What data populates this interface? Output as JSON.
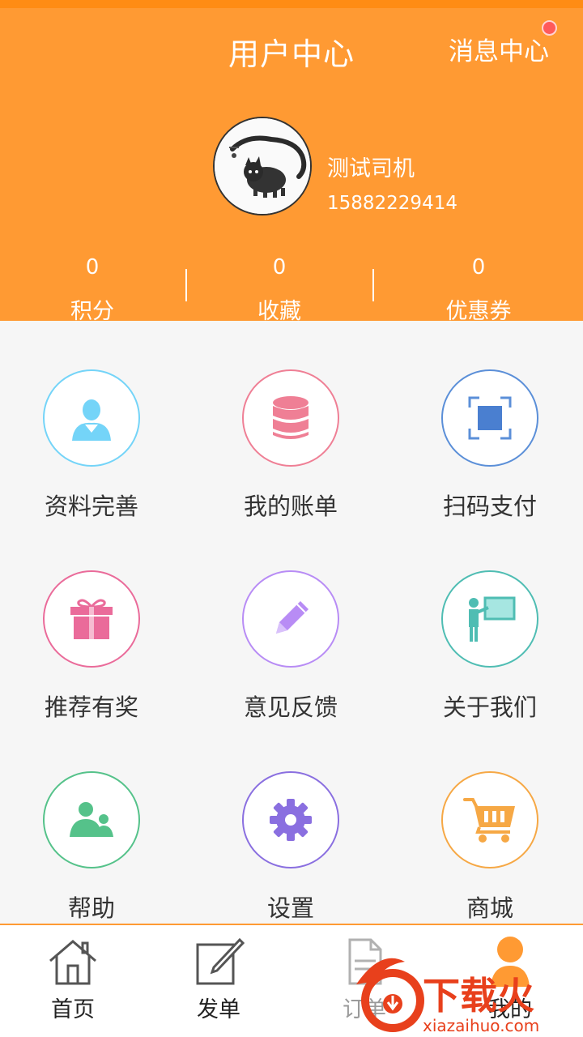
{
  "header": {
    "title": "用户中心",
    "message_center": "消息中心",
    "user": {
      "name": "测试司机",
      "phone": "15882229414"
    },
    "stats": [
      {
        "value": "0",
        "label": "积分"
      },
      {
        "value": "0",
        "label": "收藏"
      },
      {
        "value": "0",
        "label": "优惠券"
      }
    ]
  },
  "grid": [
    {
      "label": "资料完善",
      "icon": "user-profile-icon",
      "color": "#74d4f8"
    },
    {
      "label": "我的账单",
      "icon": "database-bill-icon",
      "color": "#ef7f95"
    },
    {
      "label": "扫码支付",
      "icon": "scan-icon",
      "color": "#5b8fd8"
    },
    {
      "label": "推荐有奖",
      "icon": "gift-icon",
      "color": "#ea6b9a"
    },
    {
      "label": "意见反馈",
      "icon": "pencil-icon",
      "color": "#b88cf5"
    },
    {
      "label": "关于我们",
      "icon": "presentation-icon",
      "color": "#4fbdb3"
    },
    {
      "label": "帮助",
      "icon": "people-icon",
      "color": "#55c28a"
    },
    {
      "label": "设置",
      "icon": "gear-icon",
      "color": "#8a6fe0"
    },
    {
      "label": "商城",
      "icon": "shopping-cart-icon",
      "color": "#f6a845"
    }
  ],
  "tabs": [
    {
      "label": "首页",
      "icon": "home-icon"
    },
    {
      "label": "发单",
      "icon": "edit-icon"
    },
    {
      "label": "订单",
      "icon": "document-icon"
    },
    {
      "label": "我的",
      "icon": "person-icon"
    }
  ],
  "watermark": {
    "brand": "下载火",
    "domain": "xiazaihuo.com"
  },
  "colors": {
    "accent": "#ff9a33",
    "badge": "#ff5a5a"
  }
}
